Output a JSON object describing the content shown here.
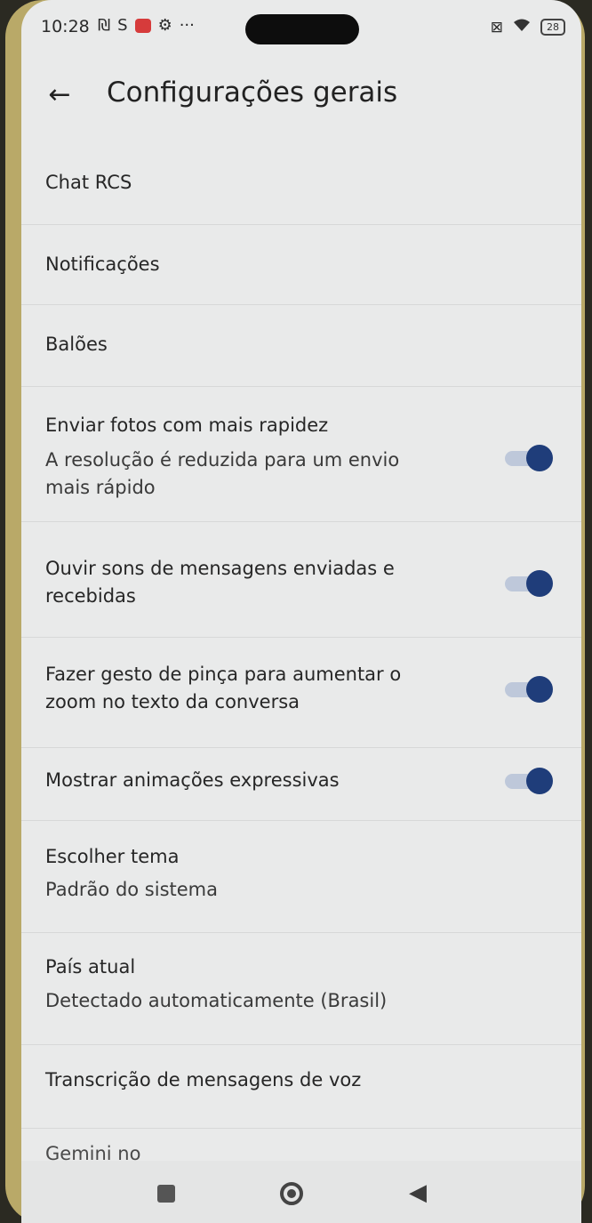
{
  "status_bar": {
    "time": "10:28",
    "icons_left": [
      "₪",
      "S",
      "⚙",
      "···"
    ],
    "icons_right": [
      "⊠",
      "wifi"
    ],
    "battery": "28"
  },
  "header": {
    "back_icon": "←",
    "title": "Configurações gerais"
  },
  "settings": {
    "chat_rcs": "Chat RCS",
    "notificacoes": "Notificações",
    "baloes": "Balões",
    "fotos": {
      "title": "Enviar fotos com mais rapidez",
      "subtitle_line1": "A resolução é reduzida para um envio",
      "subtitle_line2": "mais rápido",
      "enabled": true
    },
    "sons": {
      "title_line1": "Ouvir sons de mensagens enviadas e",
      "title_line2": "recebidas",
      "enabled": true
    },
    "pinca": {
      "title_line1": "Fazer gesto de pinça para aumentar o",
      "title_line2": "zoom no texto da conversa",
      "enabled": true
    },
    "animacoes": {
      "title": "Mostrar animações expressivas",
      "enabled": true
    },
    "tema": {
      "title": "Escolher tema",
      "subtitle": "Padrão do sistema"
    },
    "pais": {
      "title": "País atual",
      "subtitle": "Detectado automaticamente (Brasil)"
    },
    "transcricao": "Transcrição de mensagens de voz",
    "gemini_peek": "Gemini no"
  },
  "nav_bar": {
    "recents_icon": "recents-square",
    "home_icon": "home-circle",
    "back_icon": "◀"
  },
  "colors": {
    "toggle_on": "#1f3d7a",
    "background": "#e9eaea"
  }
}
